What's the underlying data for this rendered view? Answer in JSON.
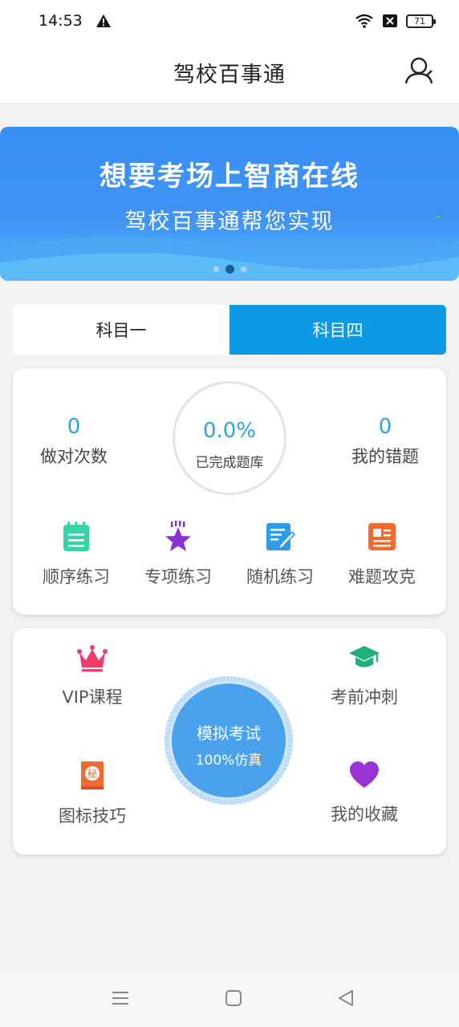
{
  "status_bar": {
    "time": "14:53",
    "battery": "71"
  },
  "header": {
    "title": "驾校百事通"
  },
  "banner": {
    "line1": "想要考场上智商在线",
    "line2": "驾校百事通帮您实现"
  },
  "tabs": [
    {
      "label": "科目一"
    },
    {
      "label": "科目四"
    }
  ],
  "stats": {
    "correct": {
      "value": "0",
      "label": "做对次数"
    },
    "progress": {
      "value": "0.0%",
      "label": "已完成题库"
    },
    "mistakes": {
      "value": "0",
      "label": "我的错题"
    }
  },
  "practice": [
    {
      "label": "顺序练习",
      "icon": "notepad-icon"
    },
    {
      "label": "专项练习",
      "icon": "star-icon"
    },
    {
      "label": "随机练习",
      "icon": "edit-icon"
    },
    {
      "label": "难题攻克",
      "icon": "news-icon"
    }
  ],
  "extras": {
    "vip": {
      "label": "VIP课程",
      "icon": "crown-icon"
    },
    "sprint": {
      "label": "考前冲刺",
      "icon": "graduation-cap-icon"
    },
    "signs": {
      "label": "图标技巧",
      "icon": "secret-book-icon",
      "icon_text": "秘"
    },
    "favorites": {
      "label": "我的收藏",
      "icon": "heart-icon"
    }
  },
  "exam": {
    "title": "模拟考试",
    "subtitle": "100%仿真"
  },
  "colors": {
    "accent": "#0c9ae4",
    "banner": "#3a8ff5",
    "number": "#2aa5e0"
  }
}
